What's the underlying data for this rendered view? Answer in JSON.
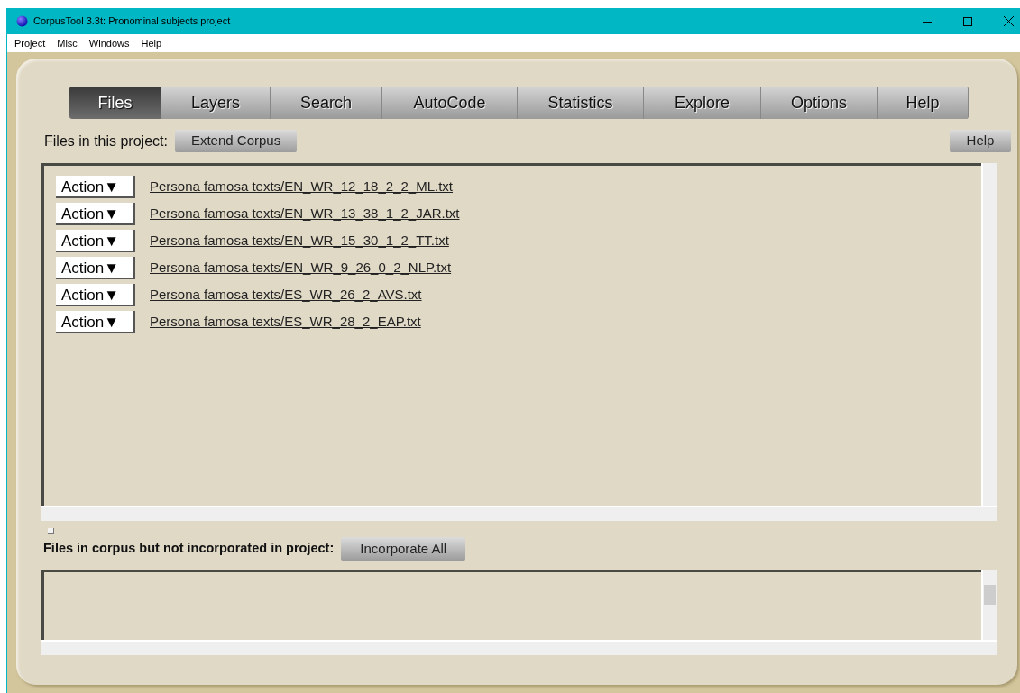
{
  "window": {
    "title": "CorpusTool 3.3t: Pronominal subjects project"
  },
  "menu": [
    "Project",
    "Misc",
    "Windows",
    "Help"
  ],
  "tabs": [
    {
      "label": "Files",
      "selected": true
    },
    {
      "label": "Layers",
      "selected": false
    },
    {
      "label": "Search",
      "selected": false
    },
    {
      "label": "AutoCode",
      "selected": false
    },
    {
      "label": "Statistics",
      "selected": false
    },
    {
      "label": "Explore",
      "selected": false
    },
    {
      "label": "Options",
      "selected": false
    },
    {
      "label": "Help",
      "selected": false
    }
  ],
  "project_files": {
    "label": "Files in this project:",
    "extend_button": "Extend Corpus",
    "help_button": "Help",
    "rows": [
      {
        "action": "Action▼",
        "file": "Persona famosa texts/EN_WR_12_18_2_2_ML.txt"
      },
      {
        "action": "Action▼",
        "file": "Persona famosa texts/EN_WR_13_38_1_2_JAR.txt"
      },
      {
        "action": "Action▼",
        "file": "Persona famosa texts/EN_WR_15_30_1_2_TT.txt"
      },
      {
        "action": "Action▼",
        "file": "Persona famosa texts/EN_WR_9_26_0_2_NLP.txt"
      },
      {
        "action": "Action▼",
        "file": "Persona famosa texts/ES_WR_26_2_AVS.txt"
      },
      {
        "action": "Action▼",
        "file": "Persona famosa texts/ES_WR_28_2_EAP.txt"
      }
    ]
  },
  "unincorporated": {
    "label": "Files in corpus but not incorporated in project:",
    "incorporate_button": "Incorporate All"
  }
}
